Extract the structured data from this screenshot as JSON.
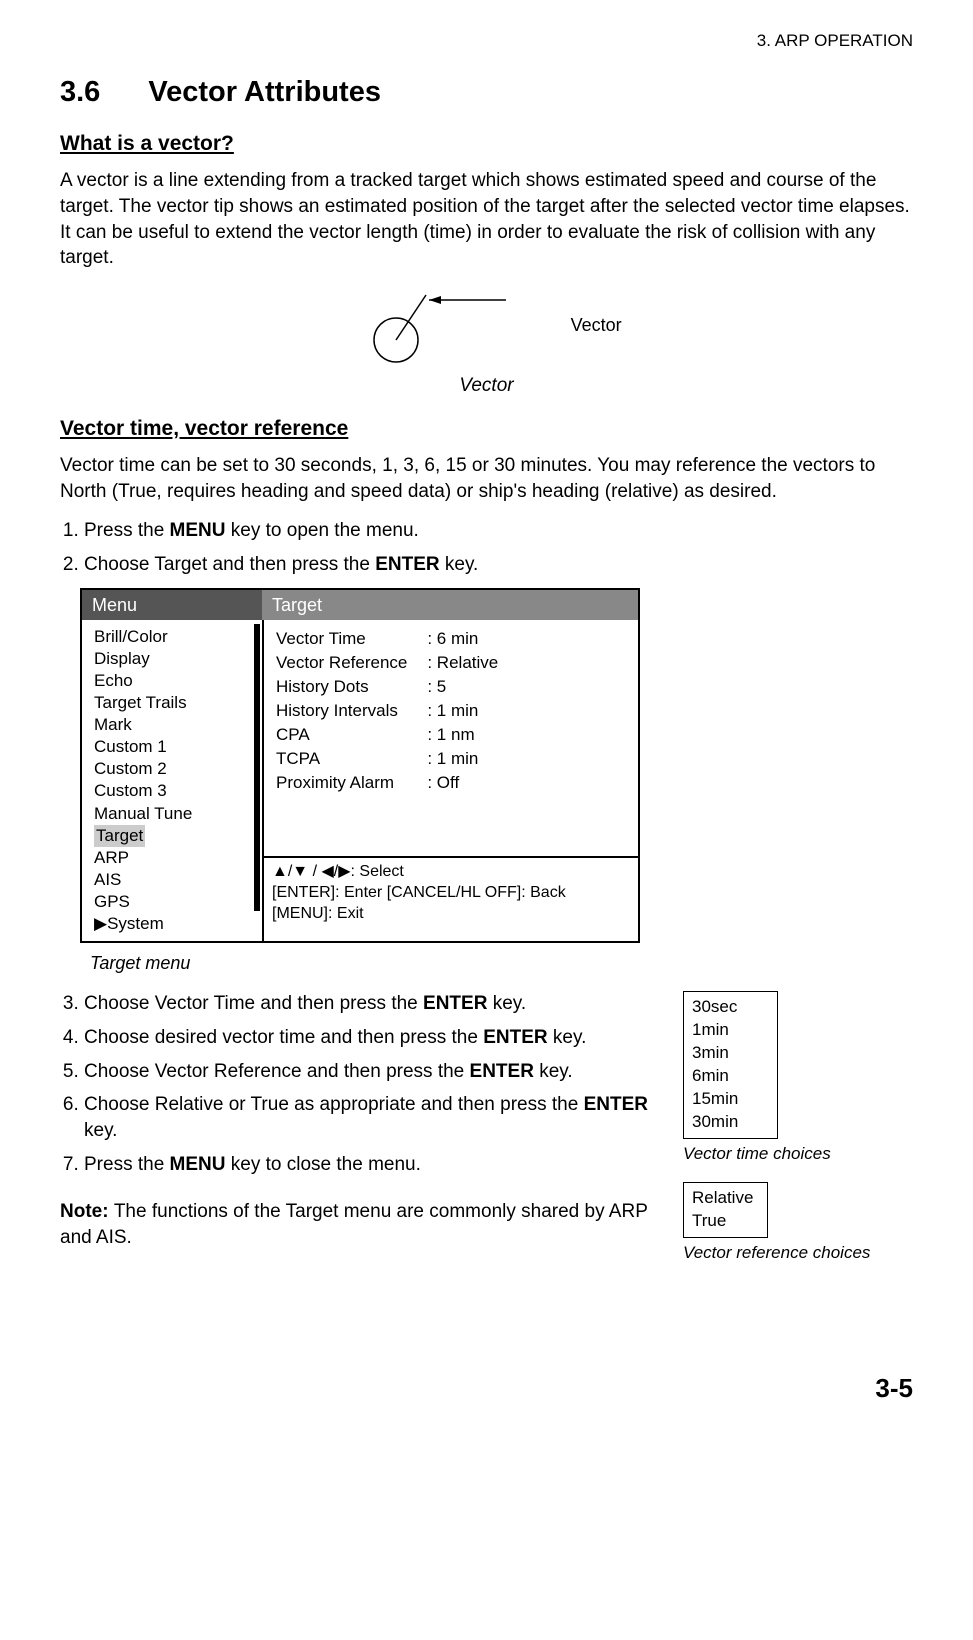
{
  "chapter_header": "3. ARP OPERATION",
  "section": {
    "number": "3.6",
    "title": "Vector Attributes"
  },
  "sub1": {
    "heading": "What is a vector?",
    "body": "A vector is a line extending from a tracked target which shows estimated speed and course of the target. The vector tip shows an estimated position of the target after the selected vector time elapses. It can be useful to extend the vector length (time) in order to evaluate the risk of collision with any target.",
    "figure_inline_label": "Vector",
    "figure_caption": "Vector"
  },
  "sub2": {
    "heading": "Vector time, vector reference",
    "intro": "Vector time can be set to 30 seconds, 1, 3, 6, 15 or 30 minutes. You may reference the vectors to North (True, requires heading and speed data) or ship's heading (relative) as desired."
  },
  "steps": {
    "s1a": "Press the ",
    "s1b": "MENU",
    "s1c": " key to open the menu.",
    "s2a": "Choose Target and then press the ",
    "s2b": "ENTER",
    "s2c": " key.",
    "s3a": "Choose Vector Time and then press the ",
    "s3b": "ENTER",
    "s3c": " key.",
    "s4a": "Choose desired vector time and then press the ",
    "s4b": "ENTER",
    "s4c": " key.",
    "s5a": "Choose Vector Reference and then press the ",
    "s5b": "ENTER",
    "s5c": " key.",
    "s6a": " Choose Relative or True as appropriate and then press the ",
    "s6b": "ENTER",
    "s6c": " key.",
    "s7a": "Press the ",
    "s7b": "MENU",
    "s7c": " key to close the menu."
  },
  "menu": {
    "left_header": "Menu",
    "right_header": "Target",
    "left_items": [
      "Brill/Color",
      "Display",
      "Echo",
      "Target Trails",
      "Mark",
      "Custom 1",
      "Custom 2",
      "Custom 3",
      "Manual Tune",
      "Target",
      "ARP",
      "AIS",
      "GPS",
      "System"
    ],
    "selected_left": "Target",
    "settings": [
      {
        "label": "Vector Time",
        "value": ": 6 min"
      },
      {
        "label": "Vector Reference",
        "value": ": Relative"
      },
      {
        "label": "History Dots",
        "value": ": 5"
      },
      {
        "label": "History Intervals",
        "value": ": 1 min"
      },
      {
        "label": "CPA",
        "value": ": 1 nm"
      },
      {
        "label": "TCPA",
        "value": ": 1 min"
      },
      {
        "label": "Proximity Alarm",
        "value": ": Off"
      }
    ],
    "hints": {
      "line1": "▲/▼ / ◀/▶: Select",
      "line2": "[ENTER]: Enter  [CANCEL/HL OFF]: Back",
      "line3": "[MENU]: Exit"
    },
    "caption": "Target menu"
  },
  "vector_time_popup": {
    "options": [
      "30sec",
      "1min",
      "3min",
      "6min",
      "15min",
      "30min"
    ],
    "selected": "30sec",
    "caption": "Vector time choices"
  },
  "vector_ref_popup": {
    "options": [
      "Relative",
      "True"
    ],
    "selected": "Relative",
    "caption": "Vector reference choices"
  },
  "note": {
    "label": "Note: ",
    "text": "The functions of the Target menu are commonly shared by ARP and AIS."
  },
  "page_number": "3-5"
}
